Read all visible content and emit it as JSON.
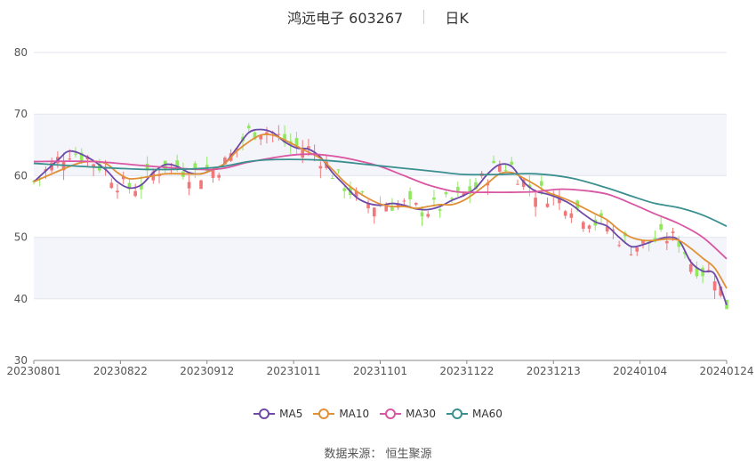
{
  "header": {
    "stock": "鸿远电子 603267",
    "period": "日K"
  },
  "source": "数据来源： 恒生聚源",
  "colors": {
    "up": "#f0787a",
    "down": "#91e85f",
    "band": "#f4f5fa",
    "grid": "#e3e6ef"
  },
  "chart_data": {
    "type": "candlestick",
    "x_ticks": [
      "20230801",
      "20230822",
      "20230912",
      "20231011",
      "20231101",
      "20231122",
      "20231213",
      "20240104",
      "20240124"
    ],
    "ylim": [
      30,
      80
    ],
    "y_ticks": [
      "30",
      "40",
      "50",
      "60",
      "70",
      "80"
    ],
    "candles_count": 117,
    "series": [
      {
        "name": "MA5",
        "color": "#6d4aa7",
        "points": [
          [
            0,
            59.0
          ],
          [
            4,
            62.5
          ],
          [
            6,
            64.0
          ],
          [
            9,
            63.0
          ],
          [
            12,
            61.0
          ],
          [
            14,
            59.0
          ],
          [
            16,
            58.0
          ],
          [
            18,
            58.5
          ],
          [
            20,
            60.5
          ],
          [
            22,
            61.8
          ],
          [
            24,
            61.5
          ],
          [
            26,
            60.5
          ],
          [
            28,
            60.3
          ],
          [
            30,
            61.0
          ],
          [
            32,
            62.0
          ],
          [
            34,
            64.5
          ],
          [
            36,
            67.0
          ],
          [
            38,
            67.5
          ],
          [
            40,
            67.0
          ],
          [
            42,
            65.5
          ],
          [
            44,
            64.5
          ],
          [
            46,
            64.3
          ],
          [
            48,
            63.0
          ],
          [
            50,
            60.5
          ],
          [
            52,
            58.5
          ],
          [
            54,
            56.5
          ],
          [
            56,
            55.5
          ],
          [
            58,
            55.2
          ],
          [
            60,
            55.5
          ],
          [
            62,
            55.2
          ],
          [
            64,
            54.6
          ],
          [
            66,
            54.5
          ],
          [
            68,
            55.0
          ],
          [
            70,
            56.0
          ],
          [
            72,
            56.8
          ],
          [
            74,
            58.0
          ],
          [
            76,
            60.3
          ],
          [
            78,
            61.8
          ],
          [
            80,
            61.5
          ],
          [
            82,
            59.0
          ],
          [
            84,
            57.5
          ],
          [
            86,
            57.0
          ],
          [
            88,
            56.3
          ],
          [
            90,
            55.3
          ],
          [
            92,
            53.8
          ],
          [
            94,
            52.5
          ],
          [
            96,
            51.8
          ],
          [
            98,
            50.0
          ],
          [
            100,
            48.5
          ],
          [
            102,
            48.8
          ],
          [
            104,
            49.5
          ],
          [
            106,
            50.0
          ],
          [
            108,
            49.5
          ],
          [
            110,
            46.0
          ],
          [
            112,
            44.5
          ],
          [
            114,
            44.0
          ],
          [
            116,
            39.0
          ]
        ]
      },
      {
        "name": "MA10",
        "color": "#e09037",
        "points": [
          [
            0,
            59.0
          ],
          [
            6,
            61.5
          ],
          [
            9,
            62.3
          ],
          [
            12,
            62.0
          ],
          [
            14,
            60.5
          ],
          [
            16,
            59.5
          ],
          [
            19,
            59.8
          ],
          [
            22,
            60.3
          ],
          [
            25,
            60.3
          ],
          [
            28,
            60.3
          ],
          [
            30,
            61.0
          ],
          [
            32,
            62.0
          ],
          [
            34,
            64.0
          ],
          [
            36,
            65.5
          ],
          [
            38,
            66.6
          ],
          [
            40,
            66.6
          ],
          [
            42,
            65.8
          ],
          [
            44,
            64.8
          ],
          [
            46,
            63.8
          ],
          [
            48,
            62.8
          ],
          [
            50,
            61.0
          ],
          [
            52,
            59.0
          ],
          [
            54,
            57.5
          ],
          [
            56,
            56.3
          ],
          [
            58,
            55.4
          ],
          [
            60,
            55.0
          ],
          [
            62,
            55.0
          ],
          [
            64,
            54.7
          ],
          [
            66,
            55.0
          ],
          [
            68,
            55.3
          ],
          [
            70,
            55.3
          ],
          [
            72,
            56.0
          ],
          [
            74,
            57.3
          ],
          [
            76,
            58.8
          ],
          [
            78,
            60.3
          ],
          [
            80,
            60.5
          ],
          [
            82,
            59.6
          ],
          [
            84,
            58.5
          ],
          [
            86,
            57.3
          ],
          [
            88,
            56.6
          ],
          [
            90,
            55.8
          ],
          [
            92,
            54.8
          ],
          [
            94,
            53.8
          ],
          [
            96,
            52.8
          ],
          [
            98,
            51.2
          ],
          [
            100,
            50.0
          ],
          [
            102,
            49.5
          ],
          [
            104,
            49.5
          ],
          [
            106,
            49.7
          ],
          [
            108,
            49.5
          ],
          [
            110,
            48.2
          ],
          [
            112,
            46.6
          ],
          [
            114,
            45.0
          ],
          [
            116,
            41.7
          ]
        ]
      },
      {
        "name": "MA30",
        "color": "#d957a3",
        "points": [
          [
            0,
            62.3
          ],
          [
            10,
            62.3
          ],
          [
            20,
            61.5
          ],
          [
            30,
            61.0
          ],
          [
            36,
            62.2
          ],
          [
            42,
            63.2
          ],
          [
            46,
            63.5
          ],
          [
            50,
            63.2
          ],
          [
            54,
            62.5
          ],
          [
            58,
            61.5
          ],
          [
            62,
            60.0
          ],
          [
            66,
            58.5
          ],
          [
            70,
            57.5
          ],
          [
            72,
            57.3
          ],
          [
            76,
            57.3
          ],
          [
            80,
            57.3
          ],
          [
            84,
            57.4
          ],
          [
            88,
            57.8
          ],
          [
            92,
            57.6
          ],
          [
            96,
            57.0
          ],
          [
            100,
            55.5
          ],
          [
            104,
            53.8
          ],
          [
            108,
            52.2
          ],
          [
            112,
            50.0
          ],
          [
            116,
            46.5
          ]
        ]
      },
      {
        "name": "MA60",
        "color": "#3a8f8f",
        "points": [
          [
            0,
            62.0
          ],
          [
            10,
            61.4
          ],
          [
            20,
            61.0
          ],
          [
            30,
            61.3
          ],
          [
            36,
            62.3
          ],
          [
            40,
            62.6
          ],
          [
            46,
            62.6
          ],
          [
            50,
            62.4
          ],
          [
            56,
            61.8
          ],
          [
            62,
            61.2
          ],
          [
            68,
            60.6
          ],
          [
            72,
            60.2
          ],
          [
            78,
            60.2
          ],
          [
            84,
            60.3
          ],
          [
            90,
            59.6
          ],
          [
            96,
            58.0
          ],
          [
            100,
            56.7
          ],
          [
            104,
            55.5
          ],
          [
            108,
            54.8
          ],
          [
            112,
            53.6
          ],
          [
            116,
            51.8
          ]
        ]
      }
    ],
    "legend": [
      "MA5",
      "MA10",
      "MA30",
      "MA60"
    ],
    "legend_position": "bottom-center",
    "grid": true
  }
}
